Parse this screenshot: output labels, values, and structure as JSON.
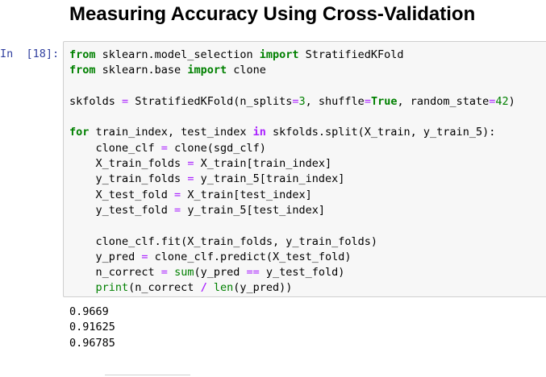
{
  "heading": "Measuring Accuracy Using Cross-Validation",
  "cell": {
    "prompt": "In  [18]:",
    "code_lines": [
      [
        {
          "t": "from",
          "c": "kw"
        },
        {
          "t": " sklearn.model_selection "
        },
        {
          "t": "import",
          "c": "kw"
        },
        {
          "t": " StratifiedKFold"
        }
      ],
      [
        {
          "t": "from",
          "c": "kw"
        },
        {
          "t": " sklearn.base "
        },
        {
          "t": "import",
          "c": "kw"
        },
        {
          "t": " clone"
        }
      ],
      [],
      [
        {
          "t": "skfolds "
        },
        {
          "t": "=",
          "c": "opl"
        },
        {
          "t": " StratifiedKFold(n_splits"
        },
        {
          "t": "=",
          "c": "opl"
        },
        {
          "t": "3",
          "c": "num"
        },
        {
          "t": ", shuffle"
        },
        {
          "t": "=",
          "c": "opl"
        },
        {
          "t": "True",
          "c": "kw"
        },
        {
          "t": ", random_state"
        },
        {
          "t": "=",
          "c": "opl"
        },
        {
          "t": "42",
          "c": "num"
        },
        {
          "t": ")"
        }
      ],
      [],
      [
        {
          "t": "for",
          "c": "kw"
        },
        {
          "t": " train_index, test_index "
        },
        {
          "t": "in",
          "c": "op"
        },
        {
          "t": " skfolds.split(X_train, y_train_5):"
        }
      ],
      [
        {
          "t": "    clone_clf "
        },
        {
          "t": "=",
          "c": "opl"
        },
        {
          "t": " clone(sgd_clf)"
        }
      ],
      [
        {
          "t": "    X_train_folds "
        },
        {
          "t": "=",
          "c": "opl"
        },
        {
          "t": " X_train[train_index]"
        }
      ],
      [
        {
          "t": "    y_train_folds "
        },
        {
          "t": "=",
          "c": "opl"
        },
        {
          "t": " y_train_5[train_index]"
        }
      ],
      [
        {
          "t": "    X_test_fold "
        },
        {
          "t": "=",
          "c": "opl"
        },
        {
          "t": " X_train[test_index]"
        }
      ],
      [
        {
          "t": "    y_test_fold "
        },
        {
          "t": "=",
          "c": "opl"
        },
        {
          "t": " y_train_5[test_index]"
        }
      ],
      [],
      [
        {
          "t": "    clone_clf.fit(X_train_folds, y_train_folds)"
        }
      ],
      [
        {
          "t": "    y_pred "
        },
        {
          "t": "=",
          "c": "opl"
        },
        {
          "t": " clone_clf.predict(X_test_fold)"
        }
      ],
      [
        {
          "t": "    n_correct "
        },
        {
          "t": "=",
          "c": "opl"
        },
        {
          "t": " "
        },
        {
          "t": "sum",
          "c": "bi"
        },
        {
          "t": "(y_pred "
        },
        {
          "t": "==",
          "c": "opl"
        },
        {
          "t": " y_test_fold)"
        }
      ],
      [
        {
          "t": "    "
        },
        {
          "t": "print",
          "c": "bi"
        },
        {
          "t": "(n_correct "
        },
        {
          "t": "/",
          "c": "op"
        },
        {
          "t": " "
        },
        {
          "t": "len",
          "c": "bi"
        },
        {
          "t": "(y_pred))"
        }
      ]
    ],
    "output_lines": [
      "0.9669",
      "0.91625",
      "0.96785"
    ]
  }
}
